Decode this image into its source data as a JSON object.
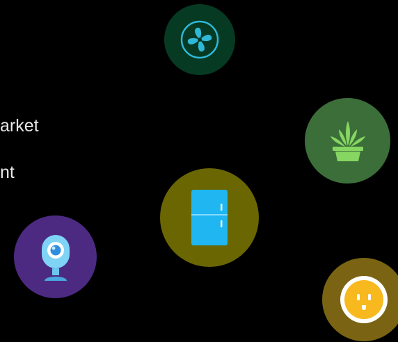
{
  "labels": {
    "line1": "arket",
    "line2": "nt"
  },
  "devices": [
    {
      "name": "fan",
      "icon": "fan-icon",
      "color": "#063a23"
    },
    {
      "name": "plant",
      "icon": "potted-plant-icon",
      "color": "#3c6e3a"
    },
    {
      "name": "fridge",
      "icon": "refrigerator-icon",
      "color": "#6a6602"
    },
    {
      "name": "camera",
      "icon": "webcam-icon",
      "color": "#4d2a82"
    },
    {
      "name": "plug",
      "icon": "smart-plug-icon",
      "color": "#7a6413"
    }
  ],
  "colors": {
    "background": "#000000",
    "text": "#e8e8e8",
    "fan_accent": "#2fb8d8",
    "plant_accent": "#86d661",
    "fridge_accent": "#1fb6f2",
    "camera_accent": "#7fd4f5",
    "plug_accent": "#f7b91e"
  }
}
